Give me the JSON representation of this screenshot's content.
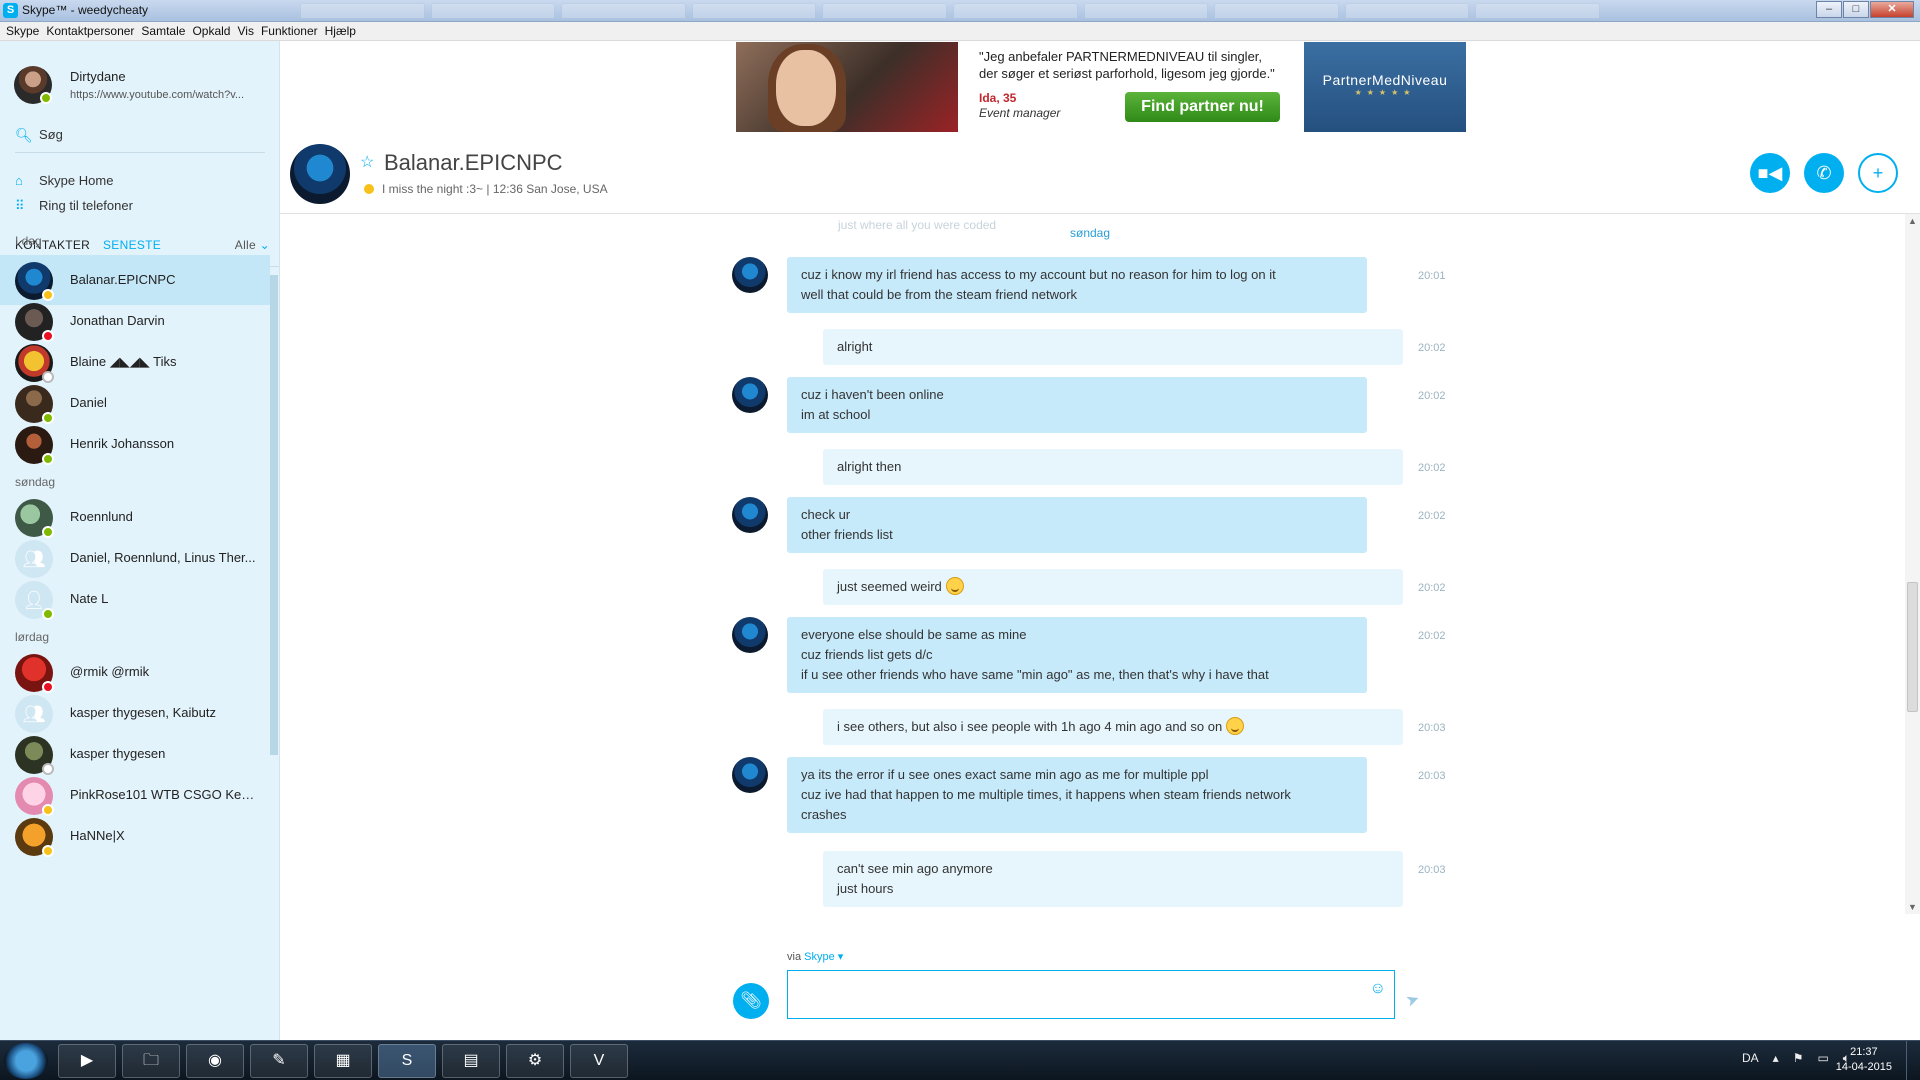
{
  "window": {
    "title": "Skype™ - weedycheaty"
  },
  "menu": [
    "Skype",
    "Kontaktpersoner",
    "Samtale",
    "Opkald",
    "Vis",
    "Funktioner",
    "Hjælp"
  ],
  "profile": {
    "name": "Dirtydane",
    "mood": "https://www.youtube.com/watch?v..."
  },
  "search": {
    "label": "Søg"
  },
  "nav": {
    "home": "Skype Home",
    "phones": "Ring til telefoner"
  },
  "tabs": {
    "contacts": "KONTAKTER",
    "recent": "SENESTE",
    "filter": "Alle"
  },
  "groups": [
    {
      "label": "I dag",
      "contacts": [
        {
          "name": "Balanar.EPICNPC",
          "status": "away"
        },
        {
          "name": "Jonathan Darvin",
          "status": "busy"
        },
        {
          "name": "Blaine ◢◣◢◣ Tiks",
          "status": "offline"
        },
        {
          "name": "Daniel",
          "status": "online"
        },
        {
          "name": "Henrik Johansson",
          "status": "online"
        }
      ]
    },
    {
      "label": "søndag",
      "contacts": [
        {
          "name": "Roennlund",
          "status": "online"
        },
        {
          "name": "Daniel, Roennlund, Linus Ther...",
          "status": "group"
        },
        {
          "name": "Nate L",
          "status": "online"
        }
      ]
    },
    {
      "label": "lørdag",
      "contacts": [
        {
          "name": "@rmik @rmik",
          "status": "busy"
        },
        {
          "name": "kasper thygesen, Kaibutz",
          "status": "group"
        },
        {
          "name": "kasper thygesen",
          "status": "offline"
        },
        {
          "name": "PinkRose101 WTB CSGO Keys...",
          "status": "away"
        },
        {
          "name": "HaNNe|X",
          "status": "away"
        }
      ]
    }
  ],
  "ad": {
    "quote_line1": "\"Jeg anbefaler PARTNERMEDNIVEAU til singler,",
    "quote_line2": "der søger et seriøst parforhold, ligesom jeg gjorde.\"",
    "person": "Ida, 35",
    "job": "Event manager",
    "cta": "Find partner nu!",
    "brand": "PartnerMedNiveau"
  },
  "conversation": {
    "name": "Balanar.EPICNPC",
    "mood": "I miss the night :3~",
    "local_time": "12:36 San Jose, USA",
    "faded_text": "just where all you were coded",
    "date_separator": "søndag",
    "messages": [
      {
        "dir": "in",
        "time": "20:01",
        "lines": [
          "cuz i know my irl friend has access to my account but no reason for him to log on it",
          "well that could be from the steam friend network"
        ]
      },
      {
        "dir": "out",
        "time": "20:02",
        "lines": [
          "alright"
        ]
      },
      {
        "dir": "in",
        "time": "20:02",
        "lines": [
          "cuz i haven't been online",
          "im at school"
        ]
      },
      {
        "dir": "out",
        "time": "20:02",
        "lines": [
          "alright then"
        ]
      },
      {
        "dir": "in",
        "time": "20:02",
        "lines": [
          "check ur",
          "other friends list"
        ]
      },
      {
        "dir": "out",
        "time": "20:02",
        "lines": [
          "just seemed weird"
        ]
      },
      {
        "dir": "in",
        "time": "20:02",
        "lines": [
          "everyone else should be same as mine",
          "cuz friends list gets d/c",
          "if u see other friends who have same \"min ago\" as me, then that's why i have that"
        ]
      },
      {
        "dir": "out",
        "time": "20:03",
        "lines": [
          "i see others, but also i see people with 1h ago 4 min ago and so on"
        ]
      },
      {
        "dir": "in",
        "time": "20:03",
        "lines": [
          "ya its the error if u see ones exact same min ago as me for multiple ppl",
          "cuz ive had that happen to me multiple times, it happens when steam friends network",
          "crashes"
        ]
      },
      {
        "dir": "out",
        "time": "20:03",
        "lines": [
          "can't see min ago anymore",
          "just hours"
        ]
      }
    ]
  },
  "compose": {
    "via_prefix": "via",
    "via_service": "Skype",
    "placeholder": ""
  },
  "taskbar": {
    "language": "DA",
    "time": "21:37",
    "date": "14-04-2015"
  }
}
